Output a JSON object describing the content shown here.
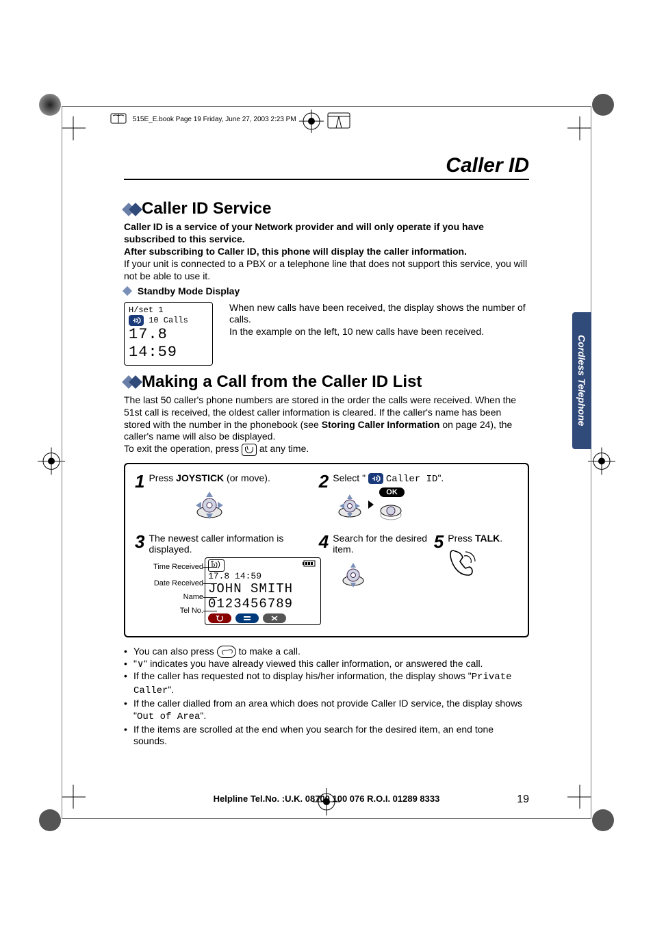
{
  "header_line": "515E_E.book  Page 19  Friday, June 27, 2003  2:23 PM",
  "page_title": "Caller ID",
  "section1_title": "Caller ID Service",
  "section1_p1": "Caller ID is a service of your Network provider and will only operate if you have subscribed to this service.",
  "section1_p2": "After subscribing to Caller ID, this phone will display the caller information.",
  "section1_p3": "If your unit is connected to a PBX or a telephone line that does not support this service, you will not be able to use it.",
  "standby_subhead": "Standby Mode Display",
  "lcd": {
    "l1": "H/set 1",
    "l2": "10 Calls",
    "l3": "17.8 14:59"
  },
  "standby_p1": "When new calls have been received, the display shows the number of calls.",
  "standby_p2": "In the example on the left, 10 new calls have been received.",
  "section2_title": "Making a Call from the Caller ID List",
  "section2_p_parts": {
    "a": "The last 50 caller's phone numbers are stored in the order the calls were received. When the 51st call is received, the oldest caller information is cleared. If the caller's name has been stored with the number in the phonebook (see ",
    "b": "Storing Caller Information",
    "c": " on page 24), the caller's name will also be displayed."
  },
  "section2_exit": "To exit the operation, press ",
  "section2_exit_tail": " at any time.",
  "steps": {
    "s1_num": "1",
    "s1": "Press ",
    "s1_b": "JOYSTICK",
    "s1_tail": " (or move).",
    "s2_num": "2",
    "s2_a": "Select \"",
    "s2_b": "  Caller ID",
    "s2_c": "\".",
    "ok": "OK",
    "s3_num": "3",
    "s3": "The newest caller information is displayed.",
    "s3_lbl_time": "Time Received",
    "s3_lbl_date": "Date Received",
    "s3_lbl_name": "Name",
    "s3_lbl_tel": "Tel No.",
    "s3_lcd": {
      "date": "17.8  14:59",
      "name": "JOHN SMITH",
      "tel": "0123456789"
    },
    "s4_num": "4",
    "s4": "Search for the desired item.",
    "s5_num": "5",
    "s5_a": "Press ",
    "s5_b": "TALK",
    "s5_c": "."
  },
  "bullets": {
    "b1_a": "You can also press ",
    "b1_b": " to make a call.",
    "b2": "\"∨\" indicates you have already viewed this caller information, or answered the call.",
    "b3_a": "If the caller has requested not to display his/her information, the display shows \"",
    "b3_code": "Private Caller",
    "b3_b": "\".",
    "b4_a": "If the caller dialled from an area which does not provide Caller ID service, the display shows \"",
    "b4_code": "Out of Area",
    "b4_b": "\".",
    "b5": "If the items are scrolled at the end when you search for the desired item, an end tone sounds."
  },
  "side_tab": "Cordless Telephone",
  "footer": {
    "help": "Helpline Tel.No. :U.K. 08700 100 076  R.O.I. 01289 8333",
    "page": "19"
  },
  "icon_names": {
    "caller_id_icon": "caller-id-list-icon",
    "antenna_icon": "antenna-signal-icon",
    "battery_icon": "battery-icon",
    "joystick": "joystick-direction-icon",
    "joystick_center": "joystick-center-icon",
    "handset_key": "handset-key-icon",
    "off_key": "power-off-key-icon"
  }
}
